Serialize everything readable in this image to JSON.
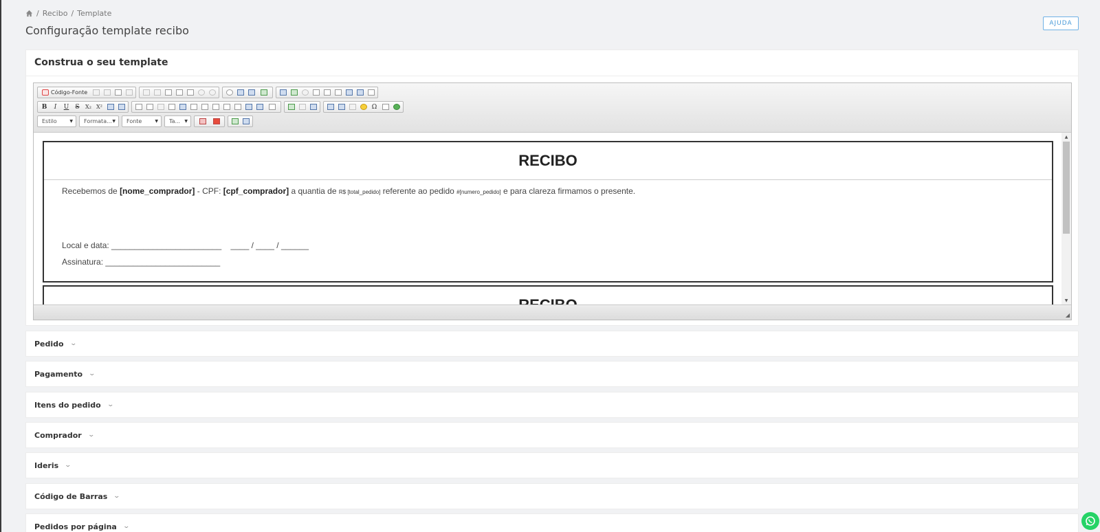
{
  "breadcrumb": {
    "home_icon": "home-icon",
    "items": [
      "Recibo",
      "Template"
    ],
    "separator": "/"
  },
  "page": {
    "title": "Configuração template recibo",
    "help_label": "AJUDA"
  },
  "builder": {
    "title": "Construa o seu template"
  },
  "toolbar": {
    "source_label": "Código-Fonte",
    "combos": [
      "Estilo",
      "Formata...",
      "Fonte",
      "Ta..."
    ],
    "format_buttons": [
      "B",
      "I",
      "U",
      "S",
      "X₂",
      "X²"
    ]
  },
  "receipt": {
    "title": "RECIBO",
    "line1_pre": "Recebemos de",
    "buyer_var": "[nome_comprador]",
    "cpf_label": "- CPF:",
    "cpf_var": "[cpf_comprador]",
    "amount_text": "a quantia de",
    "total_var": "R$ [total_pedido]",
    "ref_text": "referente ao pedido",
    "order_var": "#[numero_pedido]",
    "closing_text": "e para clareza firmamos o presente.",
    "local_label": "Local e data: ________________________    ____ / ____ / ______",
    "signature_label": "Assinatura: _________________________"
  },
  "sections": [
    "Pedido",
    "Pagamento",
    "Itens do pedido",
    "Comprador",
    "Ideris",
    "Código de Barras",
    "Pedidos por página"
  ],
  "colors": {
    "help_border": "#6fb1e6",
    "whatsapp": "#25d366"
  }
}
